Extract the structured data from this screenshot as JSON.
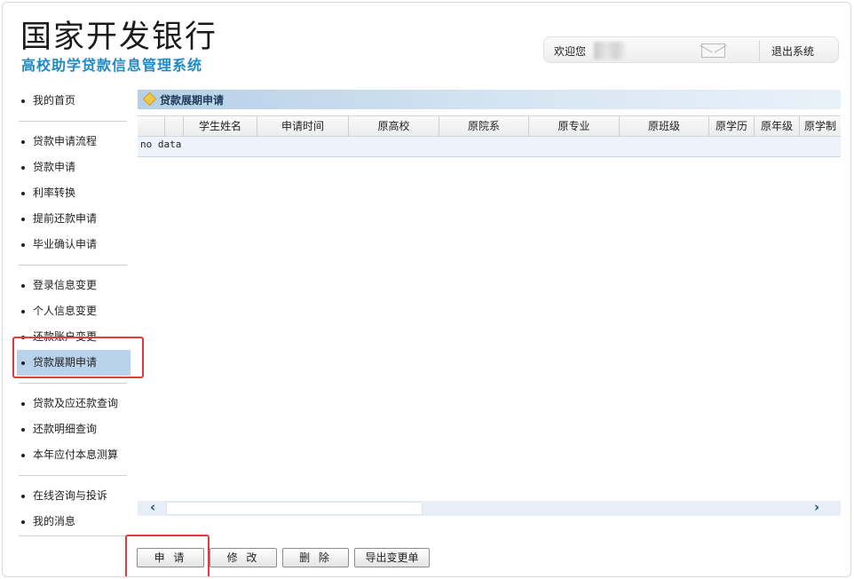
{
  "header": {
    "bank_name": "国家开发银行",
    "system_name": "高校助学贷款信息管理系统"
  },
  "userbar": {
    "welcome": "欢迎您",
    "logout": "退出系统",
    "mail_icon": "mail-icon"
  },
  "sidebar": {
    "groups": [
      [
        "我的首页"
      ],
      [
        "贷款申请流程",
        "贷款申请",
        "利率转换",
        "提前还款申请",
        "毕业确认申请"
      ],
      [
        "登录信息变更",
        "个人信息变更",
        "还款账户变更",
        "贷款展期申请"
      ],
      [
        "贷款及应还款查询",
        "还款明细查询",
        "本年应付本息测算"
      ],
      [
        "在线咨询与投诉",
        "我的消息"
      ]
    ],
    "active": "贷款展期申请"
  },
  "panel": {
    "title": "贷款展期申请",
    "icon": "diamond-icon"
  },
  "grid": {
    "columns": [
      "",
      "",
      "学生姓名",
      "申请时间",
      "原高校",
      "原院系",
      "原专业",
      "原班级",
      "原学历",
      "原年级",
      "原学制"
    ],
    "empty_text": "no data"
  },
  "scrollbar": {
    "left_arrow": "‹",
    "right_arrow": "›"
  },
  "buttons": {
    "apply": "申 请",
    "modify": "修 改",
    "delete": "删 除",
    "export": "导出变更单"
  },
  "colors": {
    "brand_blue": "#1f8bc6",
    "active_bg": "#b9d3ec",
    "highlight_red": "#e53a3a"
  }
}
